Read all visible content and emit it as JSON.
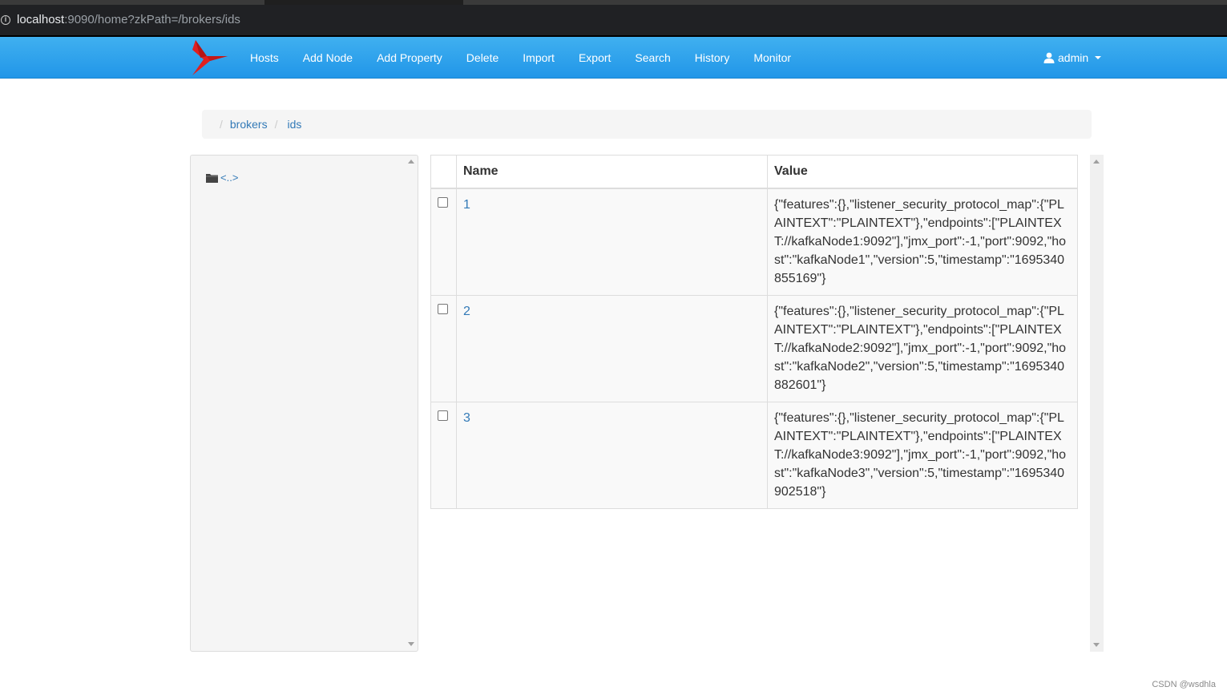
{
  "browser": {
    "url_host": "localhost",
    "url_rest": ":9090/home?zkPath=/brokers/ids"
  },
  "navbar": {
    "brand_icon": "hummingbird-logo",
    "items": [
      "Hosts",
      "Add Node",
      "Add Property",
      "Delete",
      "Import",
      "Export",
      "Search",
      "History",
      "Monitor"
    ],
    "user": "admin",
    "accent": "#2196e8"
  },
  "breadcrumb": {
    "separator": "/",
    "items": [
      "brokers",
      "ids"
    ]
  },
  "tree": {
    "items": [
      {
        "icon": "folder-icon",
        "label": "<..>"
      }
    ]
  },
  "table": {
    "columns": [
      "Name",
      "Value"
    ],
    "rows": [
      {
        "name": "1",
        "value": "{\"features\":{},\"listener_security_protocol_map\":{\"PLAINTEXT\":\"PLAINTEXT\"},\"endpoints\":[\"PLAINTEXT://kafkaNode1:9092\"],\"jmx_port\":-1,\"port\":9092,\"host\":\"kafkaNode1\",\"version\":5,\"timestamp\":\"1695340855169\"}"
      },
      {
        "name": "2",
        "value": "{\"features\":{},\"listener_security_protocol_map\":{\"PLAINTEXT\":\"PLAINTEXT\"},\"endpoints\":[\"PLAINTEXT://kafkaNode2:9092\"],\"jmx_port\":-1,\"port\":9092,\"host\":\"kafkaNode2\",\"version\":5,\"timestamp\":\"1695340882601\"}"
      },
      {
        "name": "3",
        "value": "{\"features\":{},\"listener_security_protocol_map\":{\"PLAINTEXT\":\"PLAINTEXT\"},\"endpoints\":[\"PLAINTEXT://kafkaNode3:9092\"],\"jmx_port\":-1,\"port\":9092,\"host\":\"kafkaNode3\",\"version\":5,\"timestamp\":\"1695340902518\"}"
      }
    ]
  },
  "watermark": "CSDN @wsdhla"
}
